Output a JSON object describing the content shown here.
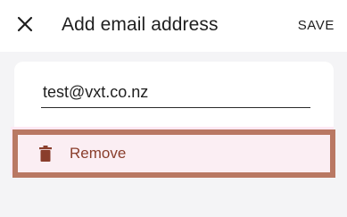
{
  "header": {
    "close_icon": "close-icon",
    "title": "Add email address",
    "save_label": "SAVE"
  },
  "form": {
    "email_value": "test@vxt.co.nz"
  },
  "remove": {
    "icon": "trash-icon",
    "label": "Remove"
  },
  "colors": {
    "background": "#f4f4f6",
    "remove_text": "#8a3e2c",
    "highlight_border": "#b97863",
    "highlight_fill": "#fde9f4"
  }
}
